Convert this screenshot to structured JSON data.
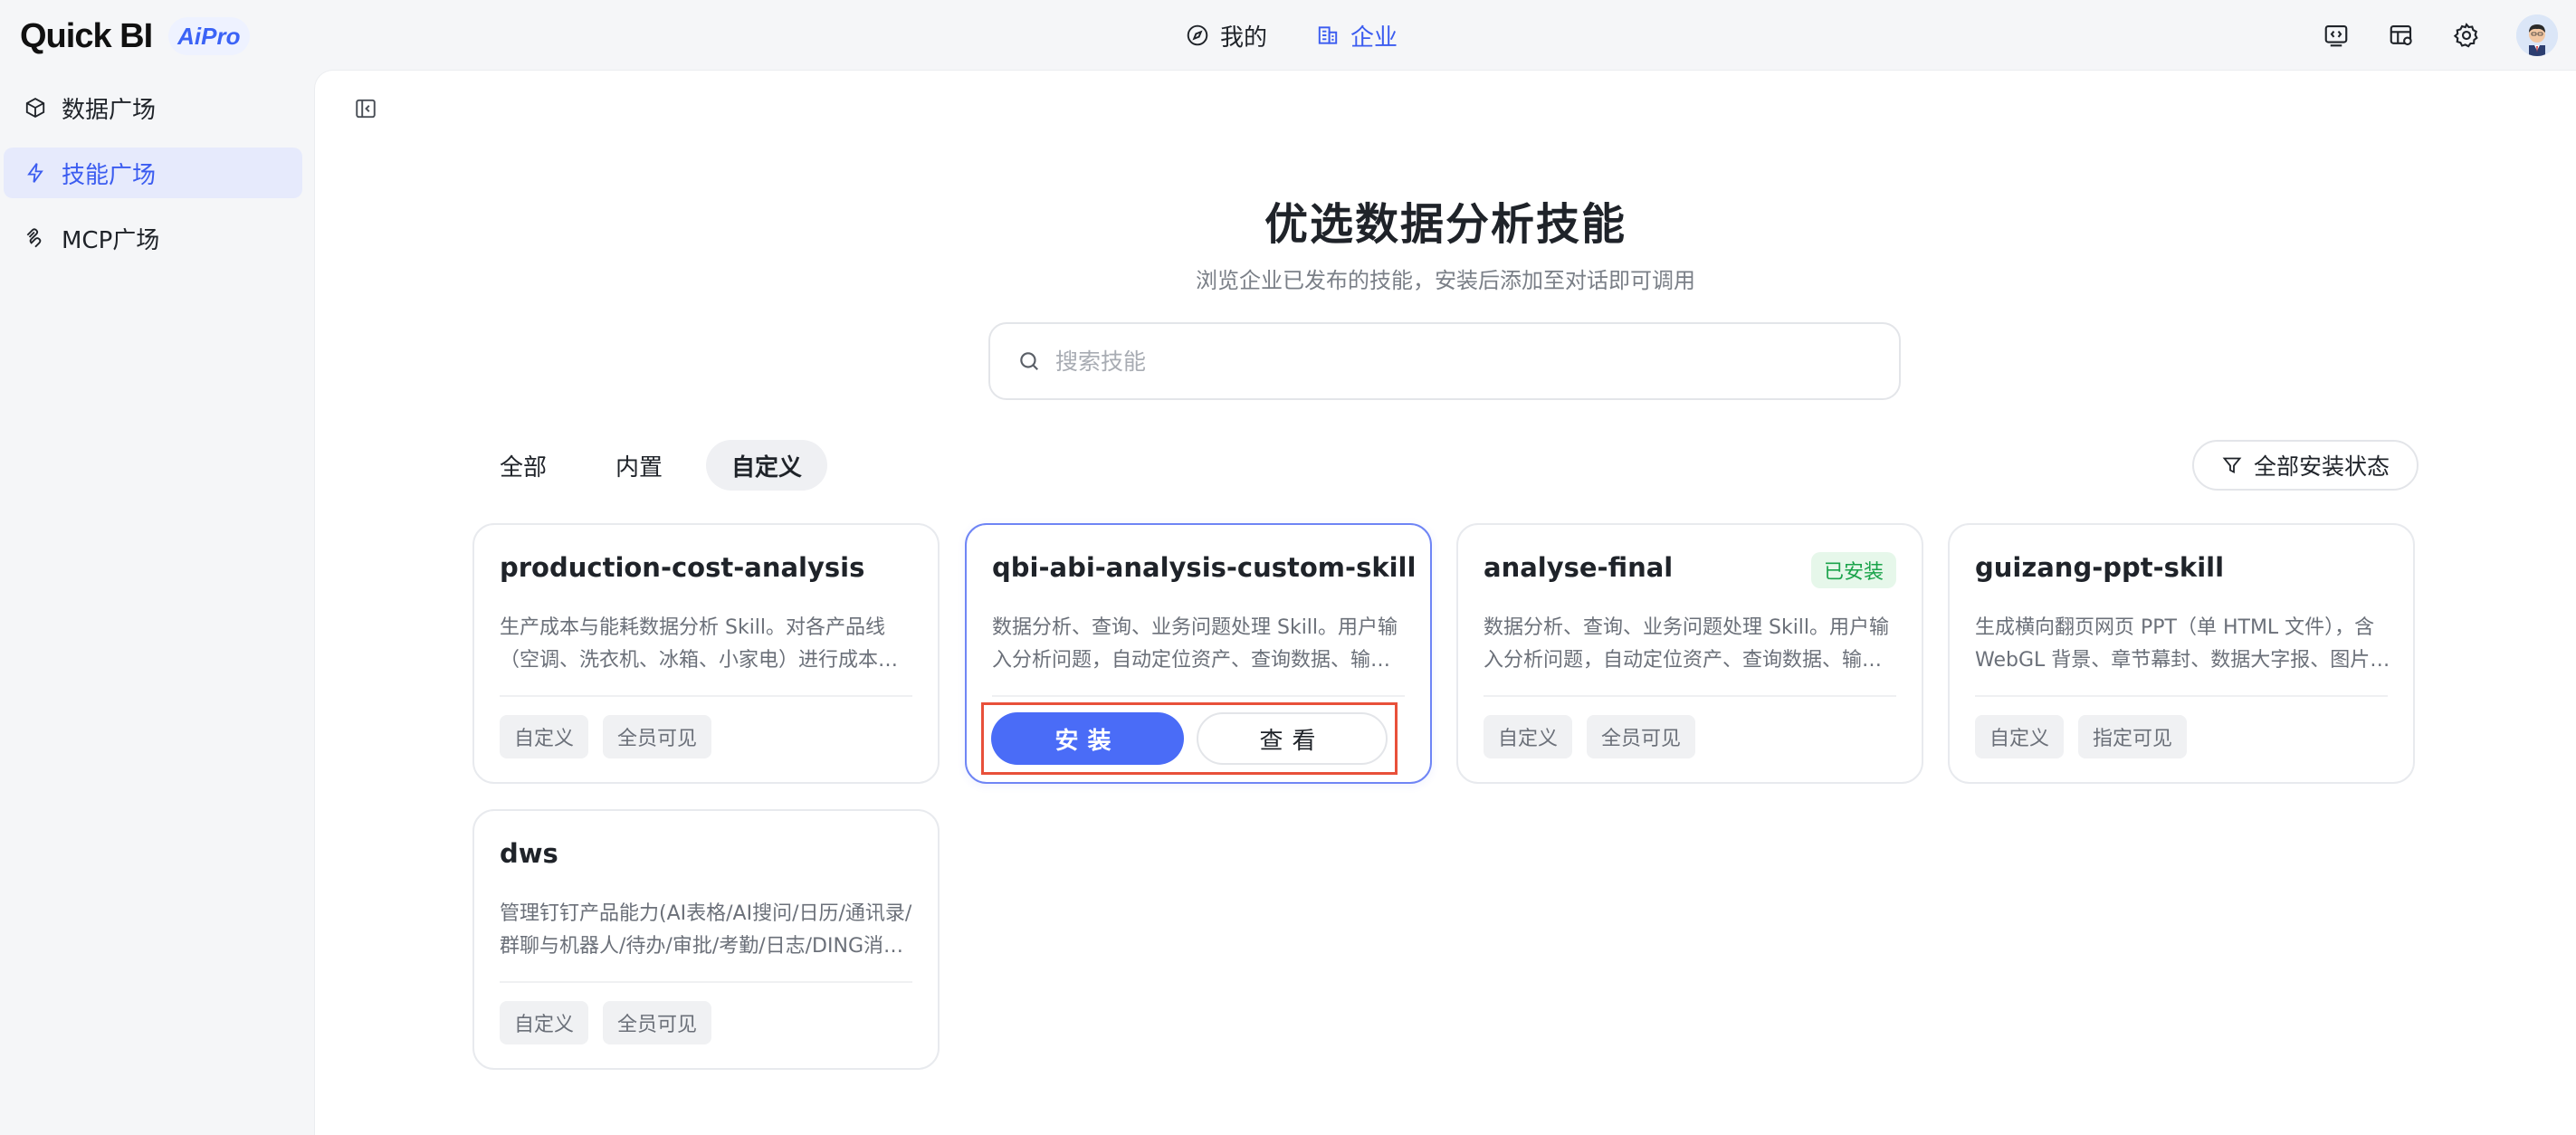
{
  "app": {
    "logo_text": "Quick BI",
    "logo_badge": "AiPro"
  },
  "topnav": {
    "items": [
      {
        "label": "我的",
        "icon": "compass-icon",
        "active": false
      },
      {
        "label": "企业",
        "icon": "building-icon",
        "active": true
      }
    ]
  },
  "topicons": [
    "code-window-icon",
    "dashboard-settings-icon",
    "gear-icon",
    "avatar"
  ],
  "sidebar": {
    "items": [
      {
        "label": "数据广场",
        "icon": "cube-icon",
        "active": false
      },
      {
        "label": "技能广场",
        "icon": "lightning-icon",
        "active": true
      },
      {
        "label": "MCP广场",
        "icon": "mcp-icon",
        "active": false
      }
    ]
  },
  "hero": {
    "title": "优选数据分析技能",
    "subtitle": "浏览企业已发布的技能，安装后添加至对话即可调用"
  },
  "search": {
    "placeholder": "搜索技能",
    "value": ""
  },
  "tabs": [
    {
      "label": "全部",
      "active": false
    },
    {
      "label": "内置",
      "active": false
    },
    {
      "label": "自定义",
      "active": true
    }
  ],
  "filter": {
    "label": "全部安装状态"
  },
  "cards": [
    {
      "title": "production-cost-analysis",
      "description": "生产成本与能耗数据分析 Skill。对各产品线（空调、洗衣机、冰箱、小家电）进行成本构成、能耗趋势等分析",
      "tags": [
        "自定义",
        "全员可见"
      ],
      "badge": ""
    },
    {
      "title": "qbi-abi-analysis-custom-skill",
      "description": "数据分析、查询、业务问题处理 Skill。用户输入分析问题，自动定位资产、查询数据、输出结论",
      "tags": [
        "自定义",
        "全员可见"
      ],
      "badge": "",
      "actions": {
        "install": "安装",
        "view": "查看"
      }
    },
    {
      "title": "analyse-final",
      "description": "数据分析、查询、业务问题处理 Skill。用户输入分析问题，自动定位资产、查询数据、输出结论",
      "tags": [
        "自定义",
        "全员可见"
      ],
      "badge": "已安装"
    },
    {
      "title": "guizang-ppt-skill",
      "description": "生成横向翻页网页 PPT（单 HTML 文件），含 WebGL 背景、章节幕封、数据大字报、图片网格等版式",
      "tags": [
        "自定义",
        "指定可见"
      ],
      "badge": ""
    },
    {
      "title": "dws",
      "description": "管理钉钉产品能力(AI表格/AI搜问/日历/通讯录/群聊与机器人/待办/审批/考勤/日志/DING消息等",
      "tags": [
        "自定义",
        "全员可见"
      ],
      "badge": ""
    }
  ],
  "colors": {
    "accent": "#3b5cf0",
    "install_button": "#4a6cf7",
    "installed_badge_bg": "#e6f7ea",
    "installed_badge_text": "#1aa34a",
    "highlight_box": "#e8503a"
  }
}
